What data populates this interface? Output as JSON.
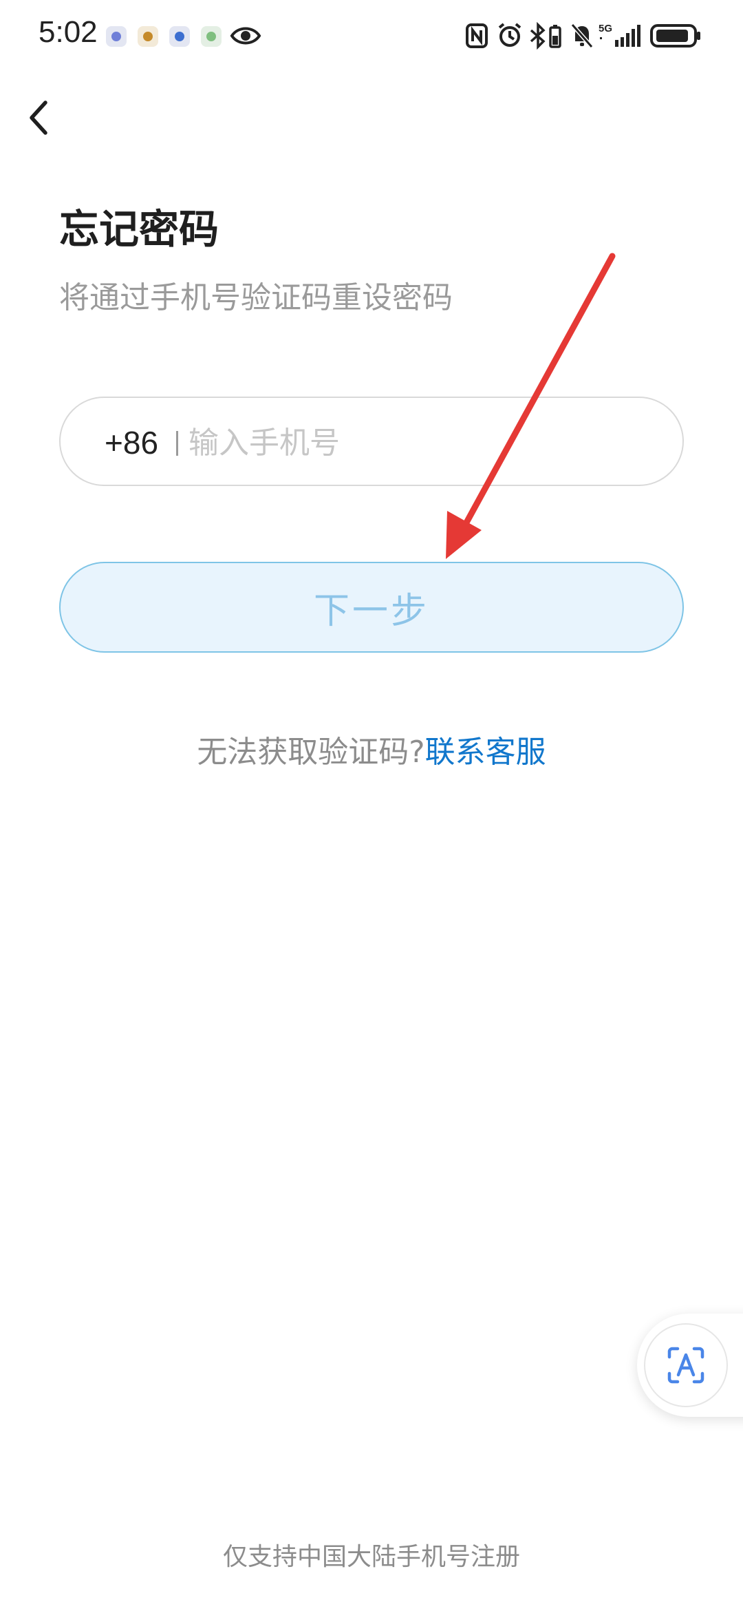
{
  "status_bar": {
    "time": "5:02",
    "notification_icons": [
      "app-icon-1",
      "app-icon-2",
      "app-icon-3",
      "app-icon-4",
      "eye-icon"
    ],
    "system_icons": [
      "nfc-icon",
      "alarm-icon",
      "bluetooth-icon",
      "mute-icon",
      "signal-5g-icon",
      "battery-icon"
    ],
    "network_label": "5G"
  },
  "nav": {
    "back_icon": "chevron-left-icon"
  },
  "page": {
    "title": "忘记密码",
    "subtitle": "将通过手机号验证码重设密码"
  },
  "phone": {
    "country_code": "+86",
    "placeholder": "输入手机号",
    "value": ""
  },
  "next_button": {
    "label": "下一步"
  },
  "help": {
    "text": "无法获取验证码?",
    "link": "联系客服"
  },
  "floating": {
    "icon": "text-scan-icon"
  },
  "footer": {
    "note": "仅支持中国大陆手机号注册"
  },
  "colors": {
    "accent_link": "#1177cc",
    "button_bg": "#e8f4fd",
    "button_border": "#7ec4e6",
    "button_text": "#8dc4e8",
    "annotation_arrow": "#e53935"
  }
}
